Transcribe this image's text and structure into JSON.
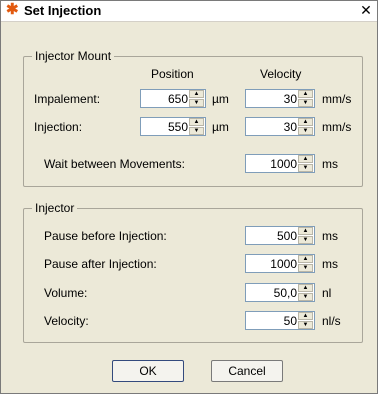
{
  "window": {
    "title": "Set Injection",
    "close": "✕"
  },
  "mount": {
    "legend": "Injector Mount",
    "col_position": "Position",
    "col_velocity": "Velocity",
    "rows": [
      {
        "label": "Impalement:",
        "position": "650",
        "position_unit": "µm",
        "velocity": "30",
        "velocity_unit": "mm/s"
      },
      {
        "label": "Injection:",
        "position": "550",
        "position_unit": "µm",
        "velocity": "30",
        "velocity_unit": "mm/s"
      }
    ],
    "wait": {
      "label": "Wait between Movements:",
      "value": "1000",
      "unit": "ms"
    }
  },
  "injector": {
    "legend": "Injector",
    "rows": [
      {
        "label": "Pause before Injection:",
        "value": "500",
        "unit": "ms"
      },
      {
        "label": "Pause after Injection:",
        "value": "1000",
        "unit": "ms"
      },
      {
        "label": "Volume:",
        "value": "50,0",
        "unit": "nl"
      },
      {
        "label": "Velocity:",
        "value": "50",
        "unit": "nl/s"
      }
    ]
  },
  "buttons": {
    "ok": "OK",
    "cancel": "Cancel"
  },
  "icons": {
    "app": "gear-star-icon",
    "spin_up": "triangle-up-icon",
    "spin_down": "triangle-down-icon"
  }
}
